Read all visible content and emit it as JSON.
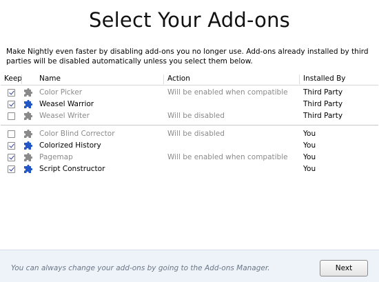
{
  "window": {
    "title": "Select Your Add-ons",
    "description": "Make Nightly even faster by disabling add-ons you no longer use. Add-ons already installed by third parties will be disabled automatically unless you select them below."
  },
  "table": {
    "headers": {
      "keep": "Keep",
      "name": "Name",
      "action": "Action",
      "installed_by": "Installed By"
    },
    "third_party": [
      {
        "checked": true,
        "enabled": false,
        "icon": "puzzle-piece-icon",
        "icon_color": "#8a8a8a",
        "name": "Color Picker",
        "action": "Will be enabled when compatible",
        "installed_by": "Third Party"
      },
      {
        "checked": true,
        "enabled": true,
        "icon": "puzzle-piece-icon",
        "icon_color": "#2357c8",
        "name": "Weasel Warrior",
        "action": "",
        "installed_by": "Third Party"
      },
      {
        "checked": false,
        "enabled": false,
        "icon": "puzzle-piece-icon",
        "icon_color": "#8a8a8a",
        "name": "Weasel Writer",
        "action": "Will be disabled",
        "installed_by": "Third Party"
      }
    ],
    "user": [
      {
        "checked": false,
        "enabled": false,
        "icon": "puzzle-piece-icon",
        "icon_color": "#8a8a8a",
        "name": "Color Blind Corrector",
        "action": "Will be disabled",
        "installed_by": "You"
      },
      {
        "checked": true,
        "enabled": true,
        "icon": "puzzle-piece-icon",
        "icon_color": "#2357c8",
        "name": "Colorized History",
        "action": "",
        "installed_by": "You"
      },
      {
        "checked": true,
        "enabled": false,
        "icon": "puzzle-piece-icon",
        "icon_color": "#8a8a8a",
        "name": "Pagemap",
        "action": "Will be enabled when compatible",
        "installed_by": "You"
      },
      {
        "checked": true,
        "enabled": true,
        "icon": "puzzle-piece-icon",
        "icon_color": "#2357c8",
        "name": "Script Constructor",
        "action": "",
        "installed_by": "You"
      }
    ]
  },
  "footer": {
    "note": "You can always change your add-ons by going to the Add-ons Manager.",
    "next_label": "Next"
  }
}
